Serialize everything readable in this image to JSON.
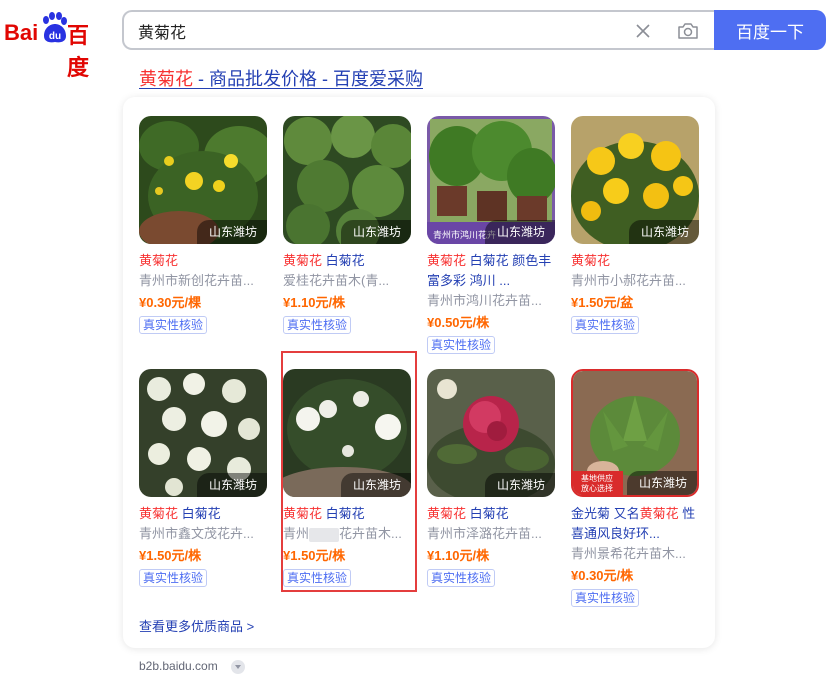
{
  "header": {
    "logo_text_bai": "Bai",
    "logo_text_du": "du",
    "logo_text_cn": "百度",
    "search_value": "黄菊花",
    "search_button": "百度一下"
  },
  "result": {
    "title_highlight": "黄菊花",
    "title_rest": " - 商品批发价格 - 百度爱采购",
    "more_link": "查看更多优质商品 >",
    "source": "b2b.baidu.com"
  },
  "products": [
    {
      "name_hl": "黄菊花",
      "name_rest": "",
      "seller": "青州市新创花卉苗...",
      "price": "¥0.30元/棵",
      "location": "山东潍坊",
      "verify": "真实性核验"
    },
    {
      "name_hl": "黄菊花",
      "name_rest": " 白菊花",
      "seller": "爱桂花卉苗木(青...",
      "price": "¥1.10元/株",
      "location": "山东潍坊",
      "verify": "真实性核验"
    },
    {
      "name_hl": "黄菊花",
      "name_rest": " 白菊花 颜色丰富多彩 鸿川 ...",
      "seller": "青州市鸿川花卉苗...",
      "price": "¥0.50元/株",
      "location": "山东潍坊",
      "verify": "真实性核验",
      "overlay_text": "青州市鸿川花卉"
    },
    {
      "name_hl": "黄菊花",
      "name_rest": "",
      "seller": "青州市小郝花卉苗...",
      "price": "¥1.50元/盆",
      "location": "山东潍坊",
      "verify": "真实性核验"
    },
    {
      "name_hl": "黄菊花",
      "name_rest": " 白菊花",
      "seller": "青州市鑫文茂花卉...",
      "price": "¥1.50元/株",
      "location": "山东潍坊",
      "verify": "真实性核验"
    },
    {
      "name_hl": "黄菊花",
      "name_rest": " 白菊花",
      "seller_pre": "青州",
      "seller_post": "花卉苗木...",
      "price": "¥1.50元/株",
      "location": "山东潍坊",
      "verify": "真实性核验"
    },
    {
      "name_hl": "黄菊花",
      "name_rest": " 白菊花",
      "seller": "青州市泽潞花卉苗...",
      "price": "¥1.10元/株",
      "location": "山东潍坊",
      "verify": "真实性核验"
    },
    {
      "name_pre": "金光菊 又名",
      "name_hl": "黄菊花",
      "name_rest": " 性喜通风良好环...",
      "seller": "青州景希花卉苗木...",
      "price": "¥0.30元/株",
      "location": "山东潍坊",
      "verify": "真实性核验",
      "overlay_line1": "基地供应",
      "overlay_line2": "放心选择"
    }
  ],
  "colors": {
    "brand_blue": "#4e6ef2",
    "link_blue": "#2440b3",
    "highlight_red": "#f73131",
    "price_orange": "#ff6600",
    "selection_border": "#e43d3d"
  }
}
